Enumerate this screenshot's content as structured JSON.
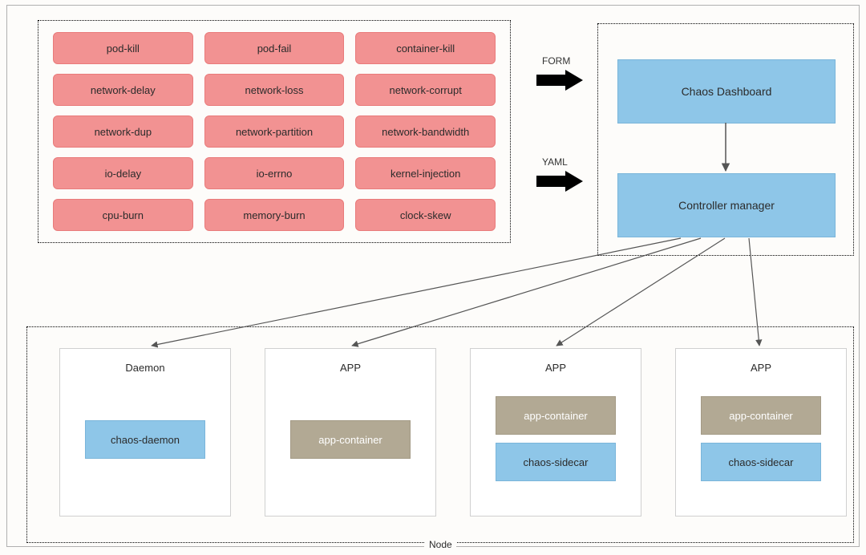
{
  "chaos_types": {
    "rows": [
      [
        "pod-kill",
        "pod-fail",
        "container-kill"
      ],
      [
        "network-delay",
        "network-loss",
        "network-corrupt"
      ],
      [
        "network-dup",
        "network-partition",
        "network-bandwidth"
      ],
      [
        "io-delay",
        "io-errno",
        "kernel-injection"
      ],
      [
        "cpu-burn",
        "memory-burn",
        "clock-skew"
      ]
    ]
  },
  "control": {
    "dashboard": "Chaos Dashboard",
    "manager": "Controller manager"
  },
  "inputs": {
    "form": "FORM",
    "yaml": "YAML"
  },
  "node": {
    "label": "Node",
    "pods": [
      {
        "title": "Daemon",
        "containers": [
          {
            "label": "chaos-daemon",
            "kind": "blue"
          }
        ]
      },
      {
        "title": "APP",
        "containers": [
          {
            "label": "app-container",
            "kind": "brown"
          }
        ]
      },
      {
        "title": "APP",
        "containers": [
          {
            "label": "app-container",
            "kind": "brown"
          },
          {
            "label": "chaos-sidecar",
            "kind": "blue"
          }
        ]
      },
      {
        "title": "APP",
        "containers": [
          {
            "label": "app-container",
            "kind": "brown"
          },
          {
            "label": "chaos-sidecar",
            "kind": "blue"
          }
        ]
      }
    ]
  },
  "colors": {
    "chaos_chip": "#f29292",
    "control_box": "#8ec6e8",
    "app_container": "#b2a994"
  }
}
